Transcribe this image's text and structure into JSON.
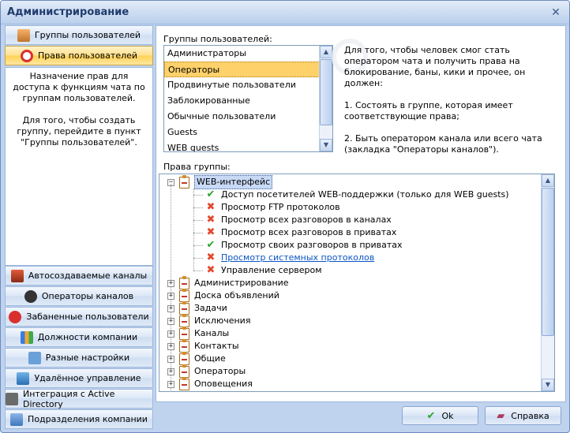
{
  "window": {
    "title": "Администрирование",
    "close_glyph": "✕"
  },
  "nav_top": [
    {
      "label": "Группы пользователей",
      "icon": "users-group-icon",
      "active": false
    },
    {
      "label": "Права пользователей",
      "icon": "forbidden-icon",
      "active": true
    }
  ],
  "description": {
    "p1": "Назначение прав для доступа к функциям чата по группам пользователей.",
    "p2": "Для того, чтобы создать группу, перейдите в пункт \"Группы пользователей\"."
  },
  "nav_bottom": [
    {
      "label": "Автосоздаваемые каналы",
      "icon": "channels-icon"
    },
    {
      "label": "Операторы каналов",
      "icon": "operator-icon"
    },
    {
      "label": "Забаненные пользователи",
      "icon": "banned-icon"
    },
    {
      "label": "Должности компании",
      "icon": "positions-icon"
    },
    {
      "label": "Разные настройки",
      "icon": "settings-icon"
    },
    {
      "label": "Удалённое управление",
      "icon": "remote-icon"
    },
    {
      "label": "Интеграция с Active Directory",
      "icon": "active-directory-icon"
    },
    {
      "label": "Подразделения компании",
      "icon": "departments-icon"
    }
  ],
  "groups": {
    "label": "Группы пользователей:",
    "items": [
      "Администраторы",
      "Операторы",
      "Продвинутые пользователи",
      "Заблокированные",
      "Обычные пользователи",
      "Guests",
      "WEB guests"
    ],
    "selected": "Операторы"
  },
  "info": {
    "p1": "Для того, чтобы человек смог стать оператором чата и получить права на блокирование, баны, кики и прочее, он должен:",
    "p2": "1. Состоять в группе, которая имеет соответствующие права;",
    "p3": "2. Быть оператором канала или всего чата (закладка \"Операторы каналов\")."
  },
  "rights": {
    "label": "Права группы:",
    "expanded_group": "WEB-интерфейс",
    "children": [
      {
        "label": "Доступ посетителей WEB-поддержки (только для WEB guests)",
        "allowed": true,
        "link": false
      },
      {
        "label": "Просмотр FTP протоколов",
        "allowed": false,
        "link": false
      },
      {
        "label": "Просмотр всех разговоров в каналах",
        "allowed": false,
        "link": false
      },
      {
        "label": "Просмотр всех разговоров в приватах",
        "allowed": false,
        "link": false
      },
      {
        "label": "Просмотр своих разговоров в приватах",
        "allowed": true,
        "link": false
      },
      {
        "label": "Просмотр системных протоколов",
        "allowed": false,
        "link": true
      },
      {
        "label": "Управление сервером",
        "allowed": false,
        "link": false
      }
    ],
    "collapsed_groups": [
      "Администрирование",
      "Доска объявлений",
      "Задачи",
      "Исключения",
      "Каналы",
      "Контакты",
      "Общие",
      "Операторы",
      "Оповещения"
    ]
  },
  "buttons": {
    "ok": "Ok",
    "help": "Справка"
  },
  "colors": {
    "accent": "#ffd16a",
    "allowed": "#2aa52a",
    "denied": "#e2492d",
    "link": "#0b55c4"
  }
}
